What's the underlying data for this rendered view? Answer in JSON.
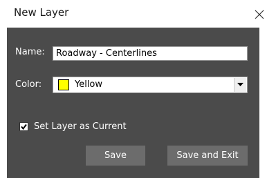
{
  "dialog": {
    "title": "New Layer"
  },
  "form": {
    "name_label": "Name:",
    "name_value": "Roadway - Centerlines",
    "color_label": "Color:",
    "color_value": "Yellow",
    "color_swatch": "#ffff00",
    "set_current_label": "Set Layer as Current",
    "set_current_checked": true
  },
  "buttons": {
    "save_label": "Save",
    "save_exit_label": "Save and Exit"
  },
  "theme": {
    "panel_bg": "#4b4b4b",
    "button_bg": "#6c6c6c"
  }
}
